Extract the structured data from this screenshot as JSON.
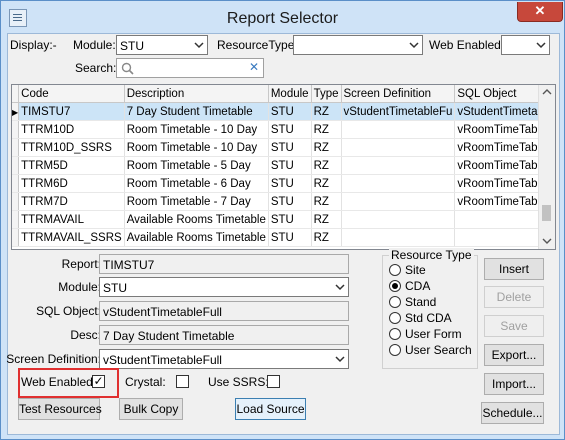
{
  "window": {
    "title": "Report Selector",
    "close_glyph": "✕"
  },
  "filters": {
    "display_label": "Display:-",
    "module_label": "Module:",
    "module_value": "STU",
    "resource_type_label": "ResourceType:",
    "resource_type_value": "",
    "web_enabled_label": "Web Enabled:",
    "web_enabled_value": "",
    "search_label": "Search:",
    "search_value": "",
    "search_clear_glyph": "✕"
  },
  "grid": {
    "columns": [
      "Code",
      "Description",
      "Module",
      "Type",
      "Screen Definition",
      "SQL Object"
    ],
    "rows": [
      [
        "TIMSTU7",
        "7 Day Student Timetable",
        "STU",
        "RZ",
        "vStudentTimetableFu",
        "vStudentTimetableFu"
      ],
      [
        "TTRM10D",
        "Room Timetable - 10 Day",
        "STU",
        "RZ",
        "",
        "vRoomTimeTableFull"
      ],
      [
        "TTRM10D_SSRS",
        "Room Timetable - 10 Day",
        "STU",
        "RZ",
        "",
        "vRoomTimeTableFull"
      ],
      [
        "TTRM5D",
        "Room Timetable - 5 Day",
        "STU",
        "RZ",
        "",
        "vRoomTimeTableFull"
      ],
      [
        "TTRM6D",
        "Room Timetable - 6 Day",
        "STU",
        "RZ",
        "",
        "vRoomTimeTableFull"
      ],
      [
        "TTRM7D",
        "Room Timetable - 7 Day",
        "STU",
        "RZ",
        "",
        "vRoomTimeTableFull"
      ],
      [
        "TTRMAVAIL",
        "Available Rooms Timetable",
        "STU",
        "RZ",
        "",
        ""
      ],
      [
        "TTRMAVAIL_SSRS",
        "Available Rooms Timetable",
        "STU",
        "RZ",
        "",
        ""
      ]
    ],
    "selected_row": 0,
    "row_pointer_glyph": "▶"
  },
  "details": {
    "report_label": "Report:",
    "report_value": "TIMSTU7",
    "module_label": "Module:",
    "module_value": "STU",
    "sql_object_label": "SQL Object:",
    "sql_object_value": "vStudentTimetableFull",
    "desc_label": "Desc:",
    "desc_value": "7 Day Student Timetable",
    "screen_def_label": "Screen Definition:",
    "screen_def_value": "vStudentTimetableFull"
  },
  "resource_type": {
    "title": "Resource Type",
    "options": [
      "Site",
      "CDA",
      "Stand",
      "Std CDA",
      "User Form",
      "User Search"
    ],
    "selected": "CDA"
  },
  "flags": {
    "web_enabled_label": "Web Enabled:",
    "web_enabled_checked": true,
    "crystal_label": "Crystal:",
    "crystal_checked": false,
    "use_ssrs_label": "Use SSRS:",
    "use_ssrs_checked": false,
    "check_glyph": "✓"
  },
  "buttons": {
    "insert": "Insert",
    "delete": "Delete",
    "save": "Save",
    "export": "Export...",
    "import": "Import...",
    "schedule": "Schedule...",
    "test_resources": "Test Resources",
    "bulk_copy": "Bulk Copy",
    "load_source": "Load Source"
  }
}
